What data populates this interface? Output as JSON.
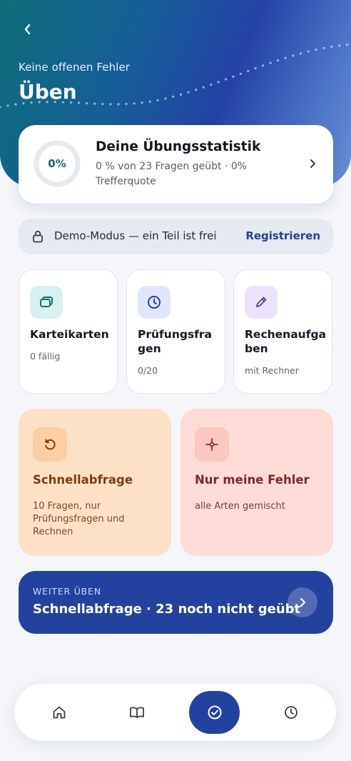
{
  "header": {
    "subtitle": "Keine offenen Fehler",
    "title": "Üben"
  },
  "stats": {
    "percent_label": "0%",
    "progress": 0,
    "title": "Deine Übungsstatistik",
    "subtitle": "0 % von 23 Fragen geübt · 0% Trefferquote"
  },
  "demo": {
    "text": "Demo-Modus — ein Teil ist frei",
    "link": "Registrieren"
  },
  "tiles": [
    {
      "title": "Karteikarten",
      "subtitle": "0 fällig",
      "icon": "cards-icon",
      "color": "#d6f1ee"
    },
    {
      "title": "Prüfungsfragen",
      "subtitle": "0/20",
      "icon": "clock-icon",
      "color": "#e1e6fb"
    },
    {
      "title": "Rechenaufgaben",
      "subtitle": "mit Rechner",
      "icon": "pencil-icon",
      "color": "#ebe2fb"
    }
  ],
  "big_cards": [
    {
      "title": "Schnellabfrage",
      "subtitle": "10 Fragen, nur Prüfungsfragen und Rechnen",
      "icon": "refresh-icon",
      "bg": "#fde1c6",
      "icon_bg": "#fbcfa3",
      "text_color": "#7a3f0f"
    },
    {
      "title": "Nur meine Fehler",
      "subtitle": "alle Arten gemischt",
      "icon": "target-icon",
      "bg": "#fddcd8",
      "icon_bg": "#fbc7c0",
      "text_color": "#8a2f2c"
    }
  ],
  "cta": {
    "kicker": "WEITER ÜBEN",
    "title": "Schnellabfrage · 23 noch nicht geübt"
  },
  "nav": {
    "items": [
      "home-icon",
      "book-icon",
      "check-circle-icon",
      "history-icon"
    ],
    "active": 2
  },
  "colors": {
    "primary": "#2342a0",
    "teal": "#116b68"
  }
}
